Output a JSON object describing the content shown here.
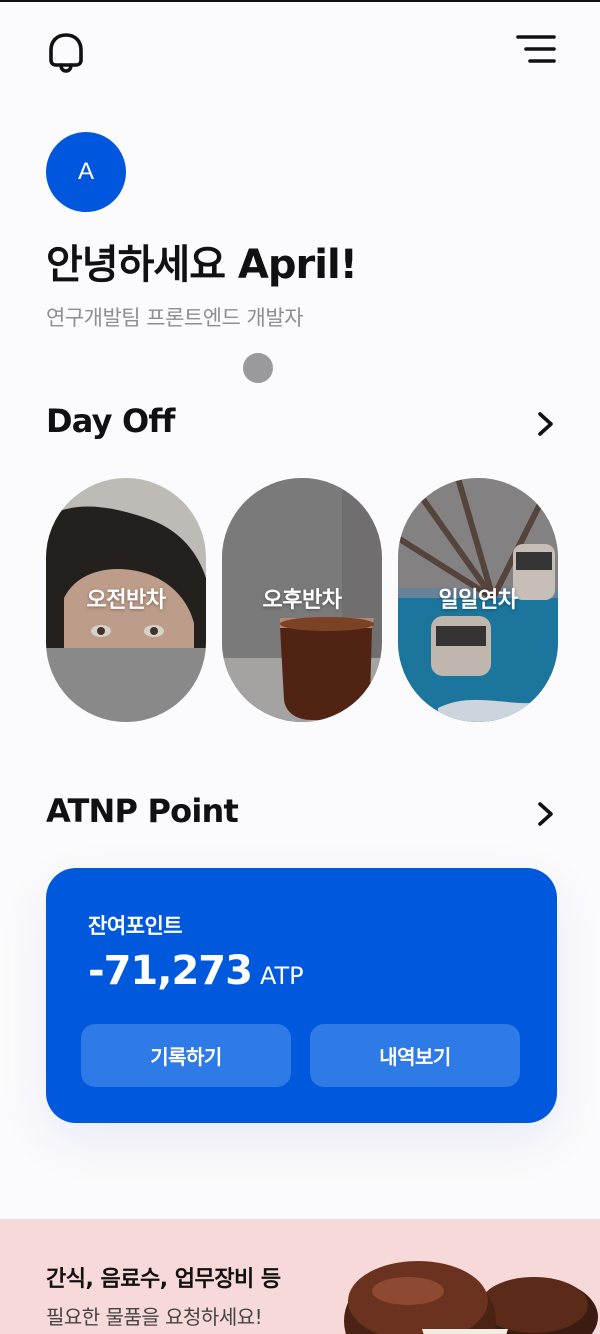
{
  "header": {
    "bell_icon": "bell-icon",
    "menu_icon": "menu-icon"
  },
  "profile": {
    "avatar_initial": "A",
    "greeting": "안녕하세요 April!",
    "role": "연구개발팀 프론트엔드 개발자"
  },
  "day_off": {
    "title": "Day Off",
    "chevron_icon": "chevron-right-icon",
    "items": [
      {
        "label": "오전반차"
      },
      {
        "label": "오후반차"
      },
      {
        "label": "일일연차"
      }
    ]
  },
  "points": {
    "title": "ATNP Point",
    "chevron_icon": "chevron-right-icon",
    "balance_label": "잔여포인트",
    "balance_value": "-71,273",
    "balance_unit": "ATP",
    "record_button": "기록하기",
    "history_button": "내역보기",
    "accent_color": "#0059dc"
  },
  "banner": {
    "title": "간식, 음료수, 업무장비 등",
    "subtitle": "필요한 물품을 요청하세요!",
    "background_color": "#f7d9d9"
  }
}
